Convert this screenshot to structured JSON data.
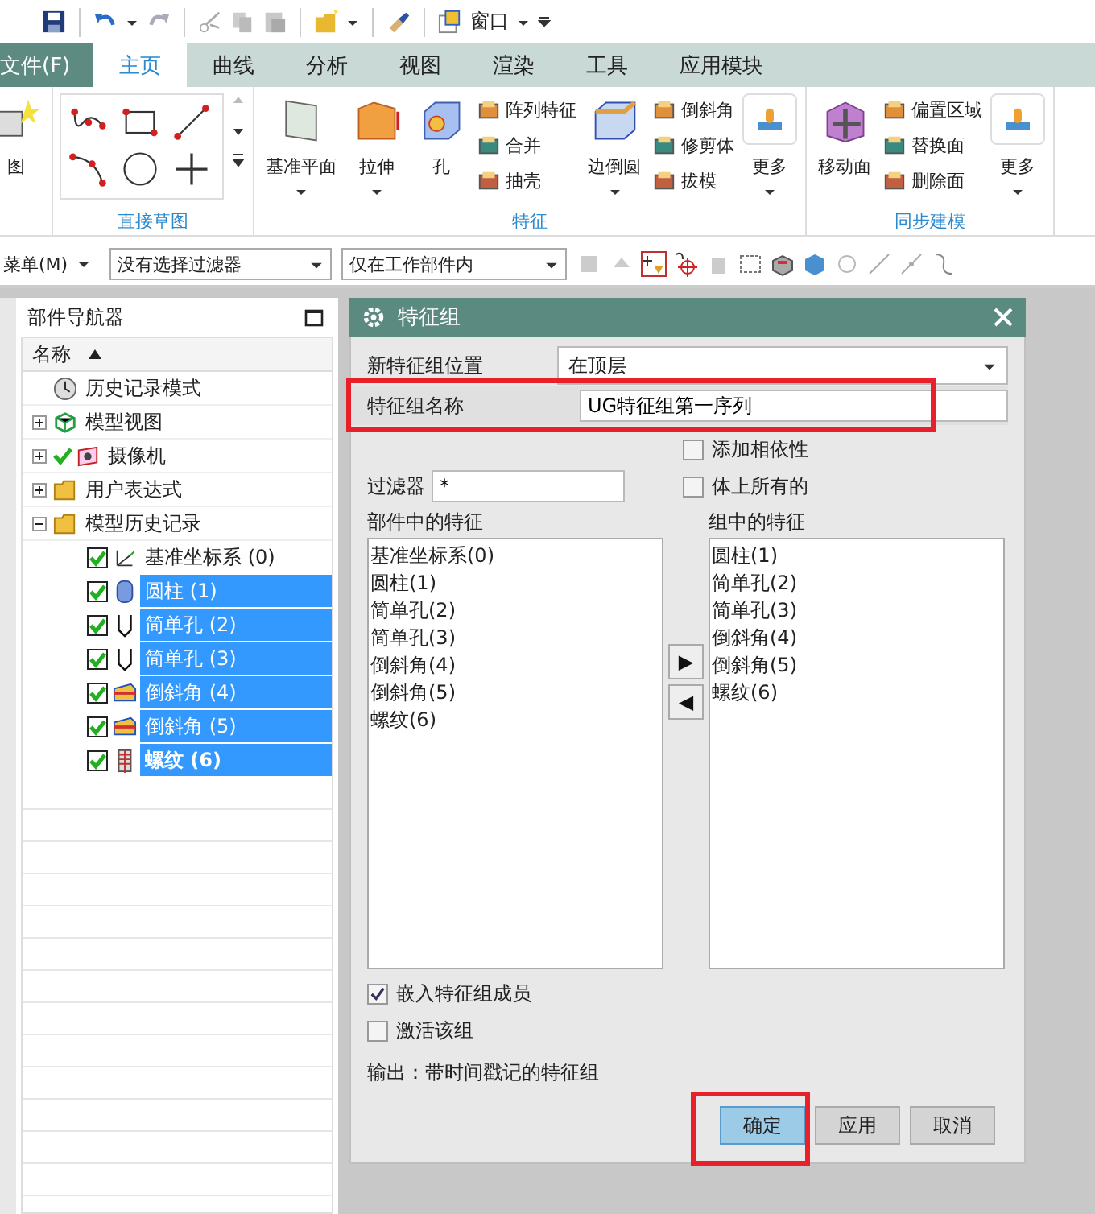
{
  "quick_access": {
    "window_menu": "窗口"
  },
  "ribbon_tabs": [
    {
      "label": "文件(F)",
      "kind": "file",
      "selected": false
    },
    {
      "label": "主页",
      "kind": "tab",
      "selected": true
    },
    {
      "label": "曲线",
      "kind": "tab",
      "selected": false
    },
    {
      "label": "分析",
      "kind": "tab",
      "selected": false
    },
    {
      "label": "视图",
      "kind": "tab",
      "selected": false
    },
    {
      "label": "渲染",
      "kind": "tab",
      "selected": false
    },
    {
      "label": "工具",
      "kind": "tab",
      "selected": false
    },
    {
      "label": "应用模块",
      "kind": "tab",
      "selected": false
    }
  ],
  "ribbon_groups": [
    {
      "items": [
        {
          "kind": "large",
          "label": "图",
          "dropdown": false
        }
      ]
    },
    {
      "title": "直接草图",
      "items": [
        {
          "kind": "sketch_grid"
        }
      ]
    },
    {
      "title": "特征",
      "items": [
        {
          "kind": "large",
          "label": "基准平面",
          "dropdown": true
        },
        {
          "kind": "large",
          "label": "拉伸",
          "dropdown": true
        },
        {
          "kind": "large",
          "label": "孔",
          "dropdown": false
        },
        {
          "kind": "stack",
          "entries": [
            "阵列特征",
            "合并",
            "抽壳"
          ]
        },
        {
          "kind": "large",
          "label": "边倒圆",
          "dropdown": true
        },
        {
          "kind": "stack",
          "entries": [
            "倒斜角",
            "修剪体",
            "拔模"
          ]
        },
        {
          "kind": "more",
          "label": "更多"
        }
      ]
    },
    {
      "title": "同步建模",
      "items": [
        {
          "kind": "large",
          "label": "移动面",
          "dropdown": false
        },
        {
          "kind": "stack",
          "entries": [
            "偏置区域",
            "替换面",
            "删除面"
          ]
        },
        {
          "kind": "more",
          "label": "更多"
        }
      ]
    }
  ],
  "selection_bar": {
    "menu": "菜单(M)",
    "filter": "没有选择过滤器",
    "scope": "仅在工作部件内"
  },
  "navigator": {
    "title": "部件导航器",
    "column": "名称",
    "items": [
      {
        "label": "历史记录模式"
      },
      {
        "label": "模型视图",
        "expanded": false
      },
      {
        "label": "摄像机",
        "expanded": false
      },
      {
        "label": "用户表达式",
        "expanded": false
      },
      {
        "label": "模型历史记录",
        "expanded": true,
        "children": [
          {
            "label": "基准坐标系 (0)",
            "checked": true,
            "selected": false,
            "bold": false
          },
          {
            "label": "圆柱 (1)",
            "checked": true,
            "selected": true,
            "bold": false
          },
          {
            "label": "简单孔 (2)",
            "checked": true,
            "selected": true,
            "bold": false
          },
          {
            "label": "简单孔 (3)",
            "checked": true,
            "selected": true,
            "bold": false
          },
          {
            "label": "倒斜角 (4)",
            "checked": true,
            "selected": true,
            "bold": false
          },
          {
            "label": "倒斜角 (5)",
            "checked": true,
            "selected": true,
            "bold": false
          },
          {
            "label": "螺纹 (6)",
            "checked": true,
            "selected": true,
            "bold": true
          }
        ]
      }
    ]
  },
  "dialog": {
    "title": "特征组",
    "position_label": "新特征组位置",
    "position_value": "在顶层",
    "name_label": "特征组名称",
    "name_value": "UG特征组第一序列",
    "name_highlighted": true,
    "options": [
      {
        "label": "添加相依性",
        "checked": false
      },
      {
        "label": "体上所有的",
        "checked": false
      }
    ],
    "filter_label": "过滤器",
    "filter_value": "*",
    "part_features_label": "部件中的特征",
    "part_features": [
      "基准坐标系(0)",
      "圆柱(1)",
      "简单孔(2)",
      "简单孔(3)",
      "倒斜角(4)",
      "倒斜角(5)",
      "螺纹(6)"
    ],
    "group_features_label": "组中的特征",
    "group_features": [
      "圆柱(1)",
      "简单孔(2)",
      "简单孔(3)",
      "倒斜角(4)",
      "倒斜角(5)",
      "螺纹(6)"
    ],
    "add_button": "▶",
    "remove_button": "◀",
    "settings": [
      {
        "label": "嵌入特征组成员",
        "checked": true
      },
      {
        "label": "激活该组",
        "checked": false
      }
    ],
    "output": "输出：带时间戳记的特征组",
    "buttons": [
      {
        "label": "确定",
        "kind": "primary",
        "highlighted": true
      },
      {
        "label": "应用",
        "kind": "normal",
        "highlighted": false
      },
      {
        "label": "取消",
        "kind": "normal",
        "highlighted": false
      }
    ]
  }
}
